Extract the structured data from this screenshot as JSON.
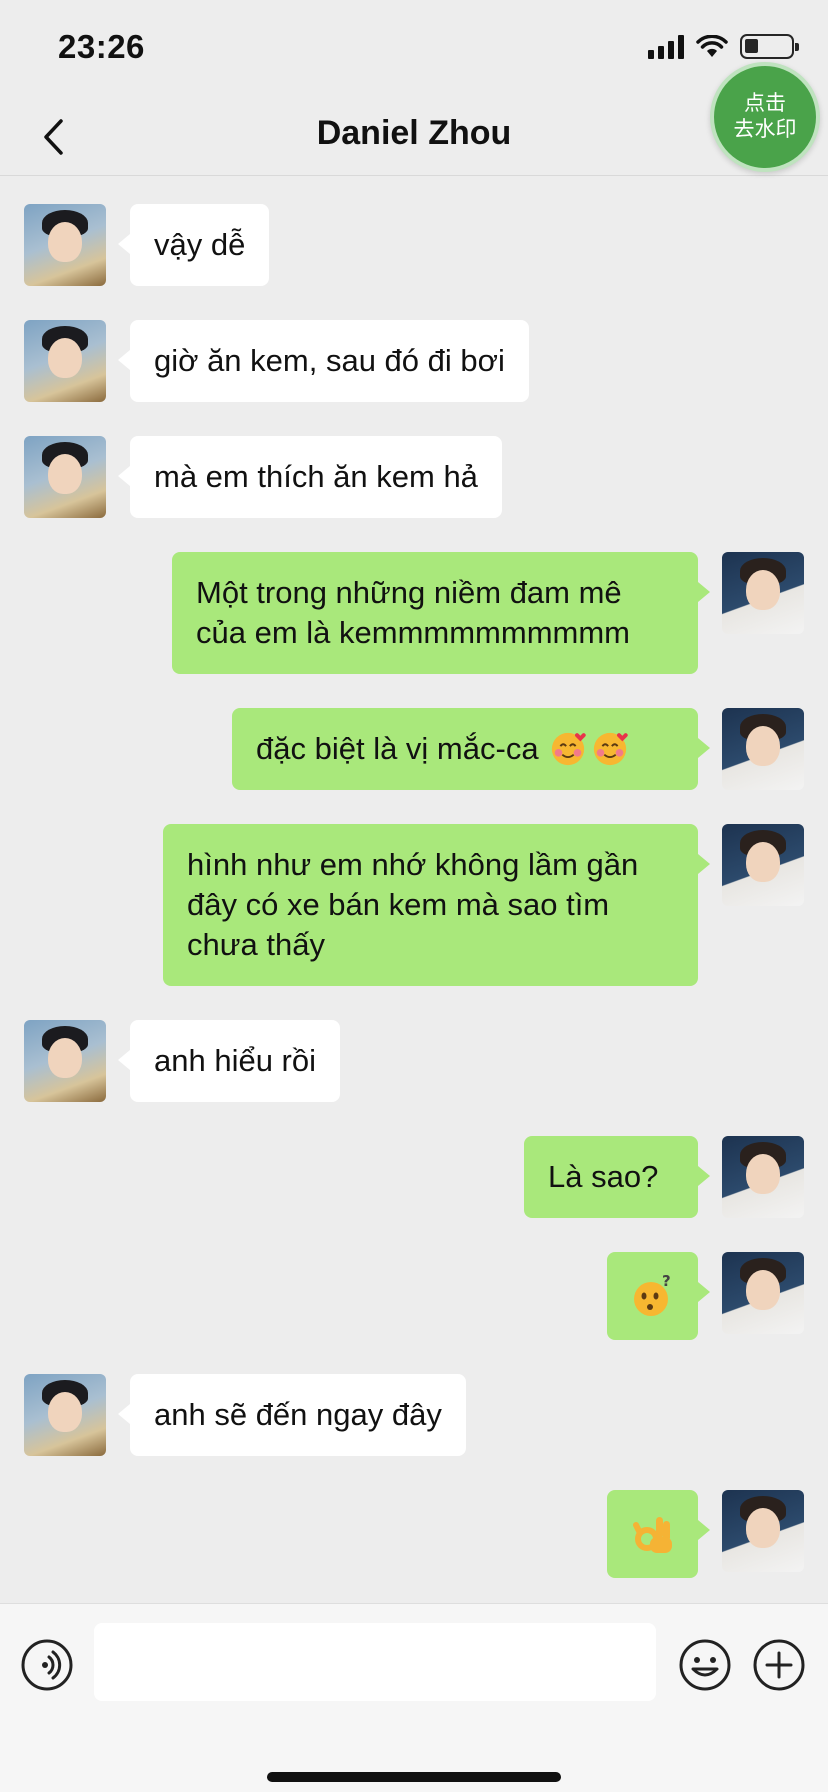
{
  "status_bar": {
    "time": "23:26"
  },
  "nav": {
    "title": "Daniel Zhou",
    "watermark_line1": "点击",
    "watermark_line2": "去水印"
  },
  "messages": [
    {
      "side": "peer",
      "text": "vậy dễ"
    },
    {
      "side": "peer",
      "text": "giờ ăn kem, sau đó đi bơi"
    },
    {
      "side": "peer",
      "text": "mà em thích ăn kem hả"
    },
    {
      "side": "self",
      "text": "Một trong những niềm đam mê của em là kemmmmmmmmmm"
    },
    {
      "side": "self",
      "text": "đặc biệt là vị mắc-ca",
      "emoji": "smiling-face-with-hearts-icon x2"
    },
    {
      "side": "self",
      "text": "hình như em nhớ không lầm gần đây có xe bán kem mà sao tìm chưa thấy"
    },
    {
      "side": "peer",
      "text": "anh hiểu rồi"
    },
    {
      "side": "self",
      "text": "Là sao?"
    },
    {
      "side": "self",
      "emoji": "confused-face-question-icon"
    },
    {
      "side": "peer",
      "text": "anh sẽ đến ngay đây"
    },
    {
      "side": "self",
      "emoji": "ok-hand-icon"
    }
  ],
  "input_bar": {
    "voice_icon": "voice-icon",
    "emoji_icon": "emoji-icon",
    "plus_icon": "plus-icon"
  },
  "colors": {
    "background": "#ededed",
    "self_bubble": "#a9e87b",
    "peer_bubble": "#ffffff",
    "watermark_button": "#4aa34a"
  }
}
